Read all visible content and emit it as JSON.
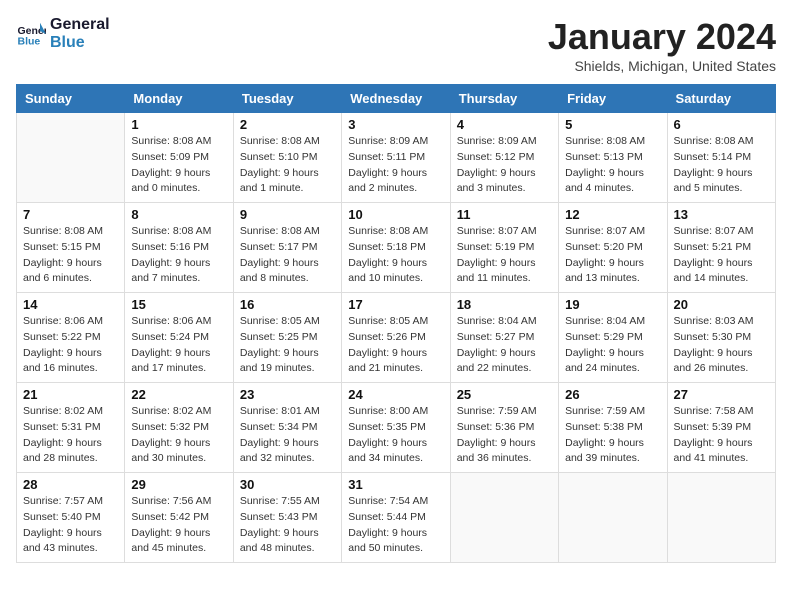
{
  "header": {
    "logo_line1": "General",
    "logo_line2": "Blue",
    "month": "January 2024",
    "location": "Shields, Michigan, United States"
  },
  "days_of_week": [
    "Sunday",
    "Monday",
    "Tuesday",
    "Wednesday",
    "Thursday",
    "Friday",
    "Saturday"
  ],
  "weeks": [
    [
      {
        "day": "",
        "info": ""
      },
      {
        "day": "1",
        "info": "Sunrise: 8:08 AM\nSunset: 5:09 PM\nDaylight: 9 hours\nand 0 minutes."
      },
      {
        "day": "2",
        "info": "Sunrise: 8:08 AM\nSunset: 5:10 PM\nDaylight: 9 hours\nand 1 minute."
      },
      {
        "day": "3",
        "info": "Sunrise: 8:09 AM\nSunset: 5:11 PM\nDaylight: 9 hours\nand 2 minutes."
      },
      {
        "day": "4",
        "info": "Sunrise: 8:09 AM\nSunset: 5:12 PM\nDaylight: 9 hours\nand 3 minutes."
      },
      {
        "day": "5",
        "info": "Sunrise: 8:08 AM\nSunset: 5:13 PM\nDaylight: 9 hours\nand 4 minutes."
      },
      {
        "day": "6",
        "info": "Sunrise: 8:08 AM\nSunset: 5:14 PM\nDaylight: 9 hours\nand 5 minutes."
      }
    ],
    [
      {
        "day": "7",
        "info": "Sunrise: 8:08 AM\nSunset: 5:15 PM\nDaylight: 9 hours\nand 6 minutes."
      },
      {
        "day": "8",
        "info": "Sunrise: 8:08 AM\nSunset: 5:16 PM\nDaylight: 9 hours\nand 7 minutes."
      },
      {
        "day": "9",
        "info": "Sunrise: 8:08 AM\nSunset: 5:17 PM\nDaylight: 9 hours\nand 8 minutes."
      },
      {
        "day": "10",
        "info": "Sunrise: 8:08 AM\nSunset: 5:18 PM\nDaylight: 9 hours\nand 10 minutes."
      },
      {
        "day": "11",
        "info": "Sunrise: 8:07 AM\nSunset: 5:19 PM\nDaylight: 9 hours\nand 11 minutes."
      },
      {
        "day": "12",
        "info": "Sunrise: 8:07 AM\nSunset: 5:20 PM\nDaylight: 9 hours\nand 13 minutes."
      },
      {
        "day": "13",
        "info": "Sunrise: 8:07 AM\nSunset: 5:21 PM\nDaylight: 9 hours\nand 14 minutes."
      }
    ],
    [
      {
        "day": "14",
        "info": "Sunrise: 8:06 AM\nSunset: 5:22 PM\nDaylight: 9 hours\nand 16 minutes."
      },
      {
        "day": "15",
        "info": "Sunrise: 8:06 AM\nSunset: 5:24 PM\nDaylight: 9 hours\nand 17 minutes."
      },
      {
        "day": "16",
        "info": "Sunrise: 8:05 AM\nSunset: 5:25 PM\nDaylight: 9 hours\nand 19 minutes."
      },
      {
        "day": "17",
        "info": "Sunrise: 8:05 AM\nSunset: 5:26 PM\nDaylight: 9 hours\nand 21 minutes."
      },
      {
        "day": "18",
        "info": "Sunrise: 8:04 AM\nSunset: 5:27 PM\nDaylight: 9 hours\nand 22 minutes."
      },
      {
        "day": "19",
        "info": "Sunrise: 8:04 AM\nSunset: 5:29 PM\nDaylight: 9 hours\nand 24 minutes."
      },
      {
        "day": "20",
        "info": "Sunrise: 8:03 AM\nSunset: 5:30 PM\nDaylight: 9 hours\nand 26 minutes."
      }
    ],
    [
      {
        "day": "21",
        "info": "Sunrise: 8:02 AM\nSunset: 5:31 PM\nDaylight: 9 hours\nand 28 minutes."
      },
      {
        "day": "22",
        "info": "Sunrise: 8:02 AM\nSunset: 5:32 PM\nDaylight: 9 hours\nand 30 minutes."
      },
      {
        "day": "23",
        "info": "Sunrise: 8:01 AM\nSunset: 5:34 PM\nDaylight: 9 hours\nand 32 minutes."
      },
      {
        "day": "24",
        "info": "Sunrise: 8:00 AM\nSunset: 5:35 PM\nDaylight: 9 hours\nand 34 minutes."
      },
      {
        "day": "25",
        "info": "Sunrise: 7:59 AM\nSunset: 5:36 PM\nDaylight: 9 hours\nand 36 minutes."
      },
      {
        "day": "26",
        "info": "Sunrise: 7:59 AM\nSunset: 5:38 PM\nDaylight: 9 hours\nand 39 minutes."
      },
      {
        "day": "27",
        "info": "Sunrise: 7:58 AM\nSunset: 5:39 PM\nDaylight: 9 hours\nand 41 minutes."
      }
    ],
    [
      {
        "day": "28",
        "info": "Sunrise: 7:57 AM\nSunset: 5:40 PM\nDaylight: 9 hours\nand 43 minutes."
      },
      {
        "day": "29",
        "info": "Sunrise: 7:56 AM\nSunset: 5:42 PM\nDaylight: 9 hours\nand 45 minutes."
      },
      {
        "day": "30",
        "info": "Sunrise: 7:55 AM\nSunset: 5:43 PM\nDaylight: 9 hours\nand 48 minutes."
      },
      {
        "day": "31",
        "info": "Sunrise: 7:54 AM\nSunset: 5:44 PM\nDaylight: 9 hours\nand 50 minutes."
      },
      {
        "day": "",
        "info": ""
      },
      {
        "day": "",
        "info": ""
      },
      {
        "day": "",
        "info": ""
      }
    ]
  ]
}
